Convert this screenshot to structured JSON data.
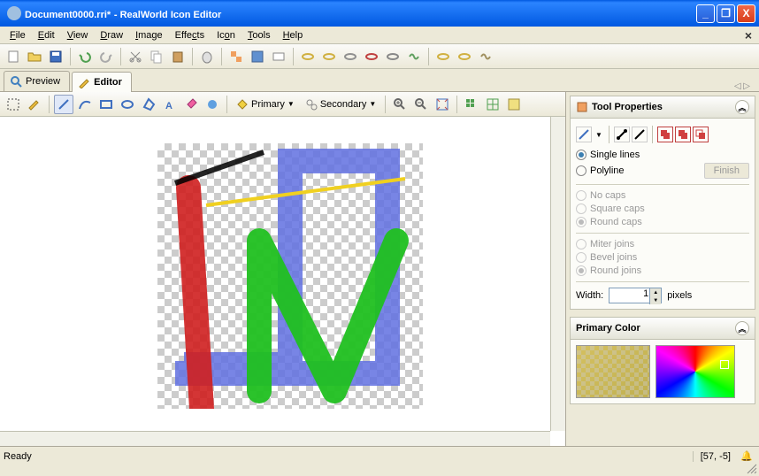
{
  "titlebar": {
    "filename": "Document0000.rri*",
    "app": "RealWorld Icon Editor"
  },
  "menu": {
    "file": "File",
    "edit": "Edit",
    "view": "View",
    "draw": "Draw",
    "image": "Image",
    "effects": "Effects",
    "icon": "Icon",
    "tools": "Tools",
    "help": "Help"
  },
  "tabs": {
    "preview": "Preview",
    "editor": "Editor"
  },
  "editor_toolbar": {
    "primary": "Primary",
    "secondary": "Secondary"
  },
  "panel_tool": {
    "title": "Tool Properties",
    "single_lines": "Single lines",
    "polyline": "Polyline",
    "finish": "Finish",
    "no_caps": "No caps",
    "square_caps": "Square caps",
    "round_caps": "Round caps",
    "miter_joins": "Miter joins",
    "bevel_joins": "Bevel joins",
    "round_joins": "Round joins",
    "width_label": "Width:",
    "width_value": "1",
    "pixels": "pixels"
  },
  "panel_color": {
    "title": "Primary Color"
  },
  "status": {
    "ready": "Ready",
    "coord": "[57, -5]"
  }
}
